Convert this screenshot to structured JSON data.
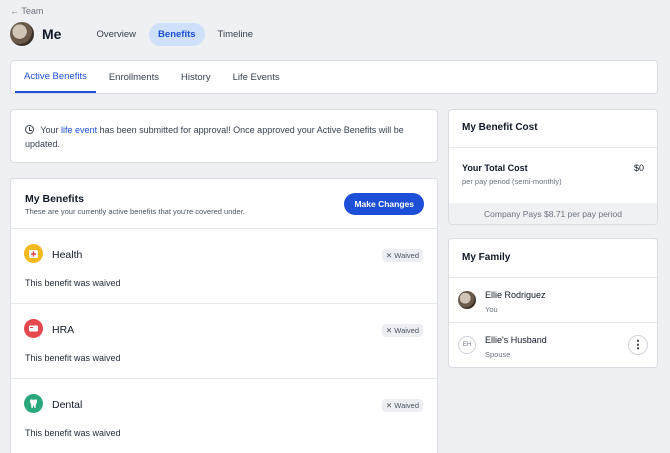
{
  "back": {
    "label": "← Team"
  },
  "header": {
    "name": "Me",
    "nav": [
      "Overview",
      "Benefits",
      "Timeline"
    ],
    "active_nav": "Benefits"
  },
  "tabs": [
    "Active Benefits",
    "Enrollments",
    "History",
    "Life Events"
  ],
  "notice": {
    "text_before": "Your",
    "link": "life event",
    "text_after": "has been submitted for approval! Once approved your Active Benefits will be updated."
  },
  "my_benefits": {
    "title": "My Benefits",
    "subtitle": "These are your currently active benefits that you're covered under.",
    "make_changes_label": "Make Changes",
    "items": [
      {
        "name": "Health",
        "status": "Waived",
        "detail": "This benefit was waived",
        "icon": "health-plus-icon",
        "color": "#f5b91d"
      },
      {
        "name": "HRA",
        "status": "Waived",
        "detail": "This benefit was waived",
        "icon": "card-icon",
        "color": "#e5484d"
      },
      {
        "name": "Dental",
        "status": "Waived",
        "detail": "This benefit was waived",
        "icon": "tooth-icon",
        "color": "#2aa87c"
      }
    ]
  },
  "benefit_cost": {
    "title": "My Benefit Cost",
    "total_label": "Your Total Cost",
    "total_value": "$0",
    "period": "per pay period (semi-monthly)",
    "company_pays": "Company Pays $8.71 per pay period"
  },
  "family": {
    "title": "My Family",
    "members": [
      {
        "name": "Ellie Rodriguez",
        "relation": "You",
        "initials": ""
      },
      {
        "name": "Ellie's Husband",
        "relation": "Spouse",
        "initials": "EH"
      }
    ]
  },
  "colors": {
    "accent": "#1d4ed8",
    "active_pill": "#cfe0fb"
  }
}
